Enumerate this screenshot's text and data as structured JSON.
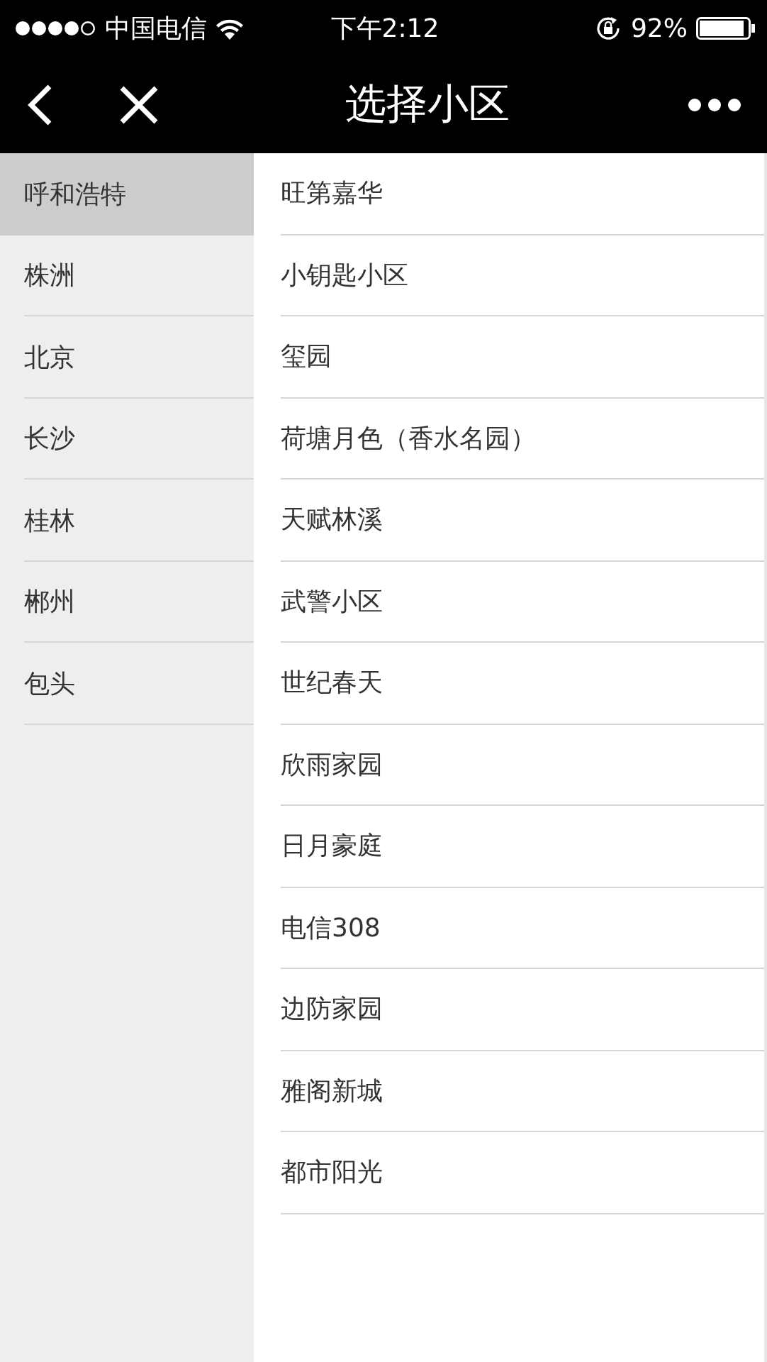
{
  "status_bar": {
    "carrier": "中国电信",
    "time": "下午2:12",
    "battery": "92%"
  },
  "nav_bar": {
    "title": "选择小区"
  },
  "cities": [
    {
      "name": "呼和浩特",
      "selected": true
    },
    {
      "name": "株洲",
      "selected": false
    },
    {
      "name": "北京",
      "selected": false
    },
    {
      "name": "长沙",
      "selected": false
    },
    {
      "name": "桂林",
      "selected": false
    },
    {
      "name": "郴州",
      "selected": false
    },
    {
      "name": "包头",
      "selected": false
    }
  ],
  "communities": [
    "旺第嘉华",
    "小钥匙小区",
    "玺园",
    "荷塘月色（香水名园）",
    "天赋林溪",
    "武警小区",
    "世纪春天",
    "欣雨家园",
    "日月豪庭",
    "电信308",
    "边防家园",
    "雅阁新城",
    "都市阳光"
  ]
}
